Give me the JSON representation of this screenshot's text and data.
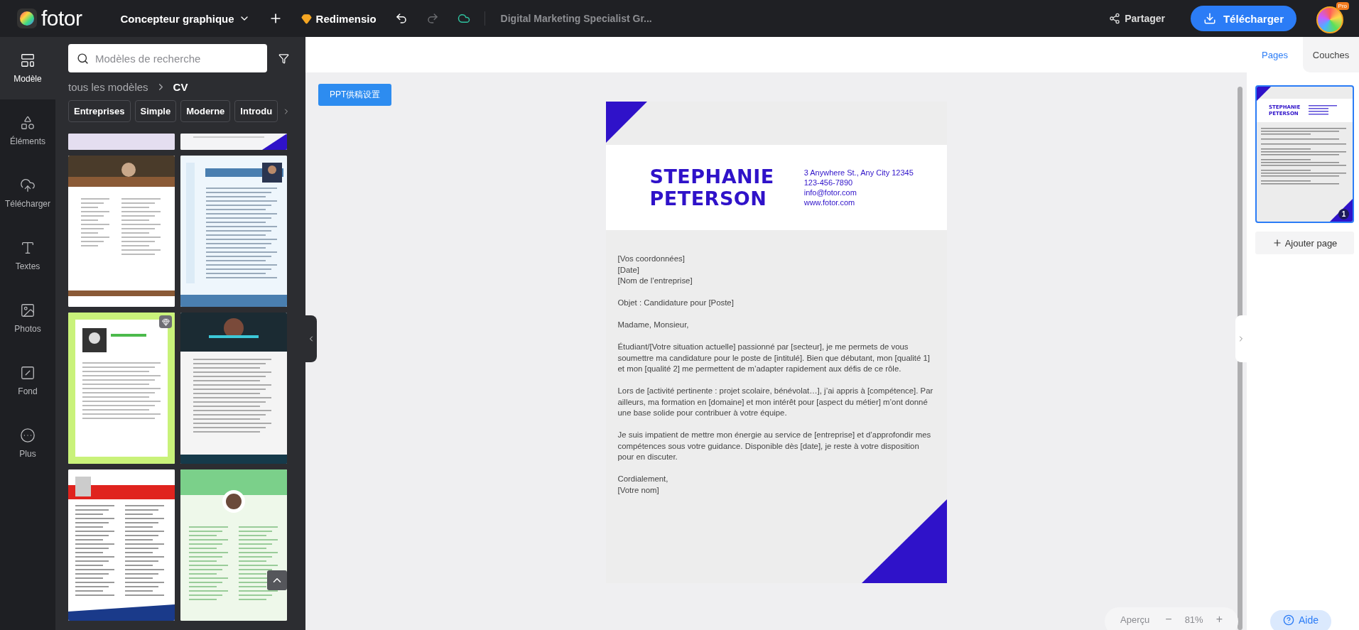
{
  "topbar": {
    "logo": "fotor",
    "mode": "Concepteur graphique",
    "resize": "Redimensio",
    "redo_disabled": true,
    "document_title": "Digital Marketing Specialist Gr...",
    "share": "Partager",
    "download": "Télécharger",
    "badge": "Pro"
  },
  "rail": [
    {
      "label": "Modèle",
      "selected": true
    },
    {
      "label": "Éléments",
      "selected": false
    },
    {
      "label": "Télécharger",
      "selected": false
    },
    {
      "label": "Textes",
      "selected": false
    },
    {
      "label": "Photos",
      "selected": false
    },
    {
      "label": "Fond",
      "selected": false
    },
    {
      "label": "Plus",
      "selected": false
    }
  ],
  "panel": {
    "search": {
      "placeholder": "Modèles de recherche"
    },
    "breadcrumb": [
      "tous les modèles",
      "CV"
    ],
    "chips": [
      "Entreprises",
      "Simple",
      "Moderne",
      "Introdu"
    ],
    "templates": [
      {
        "kind": "picture",
        "premium": false
      },
      {
        "kind": "picture",
        "premium": false
      },
      {
        "kind": "picture",
        "premium": false
      },
      {
        "kind": "picture",
        "premium": false
      },
      {
        "kind": "picture",
        "premium": true
      },
      {
        "kind": "picture",
        "premium": false
      },
      {
        "kind": "picture",
        "premium": false
      },
      {
        "kind": "picture",
        "premium": false
      }
    ]
  },
  "canvas": {
    "ppt_button": "PPT供稿设置",
    "document": {
      "name": [
        "STEPHANIE",
        "PETERSON"
      ],
      "contact": [
        "3 Anywhere St., Any City 12345",
        "123-456-7890",
        "info@fotor.com",
        "www.fotor.com"
      ],
      "body": [
        [
          "[Vos coordonnées]",
          "[Date]",
          "[Nom de l’entreprise]"
        ],
        [
          "Objet : Candidature pour [Poste]"
        ],
        [
          "Madame, Monsieur,"
        ],
        [
          "Étudiant/[Votre situation actuelle] passionné par [secteur], je me permets de vous soumettre ma candidature pour le poste de [intitulé]. Bien que débutant, mon [qualité 1] et mon [qualité 2] me permettent de m’adapter rapidement aux défis de ce rôle."
        ],
        [
          "Lors de [activité pertinente : projet scolaire, bénévolat…], j’ai appris à [compétence]. Par ailleurs, ma formation en [domaine] et mon intérêt pour [aspect du métier] m’ont donné une base solide pour contribuer à votre équipe."
        ],
        [
          "Je suis impatient de mettre mon énergie au service de [entreprise] et d’approfondir mes compétences sous votre guidance. Disponible dès [date], je reste à votre disposition pour en discuter."
        ],
        [
          "Cordialement,",
          "[Votre nom]"
        ]
      ]
    },
    "zoom": {
      "preview": "Aperçu",
      "minus": "−",
      "value": "81%",
      "plus": "+"
    }
  },
  "right_panel": {
    "tabs": [
      {
        "label": "Pages",
        "selected": true
      },
      {
        "label": "Couches",
        "selected": false
      }
    ],
    "thumbnail": {
      "name": [
        "STEPHANIE",
        "PETERSON"
      ],
      "page_number": "1",
      "selected": true
    },
    "add_page": "Ajouter page",
    "help": "Aide"
  }
}
